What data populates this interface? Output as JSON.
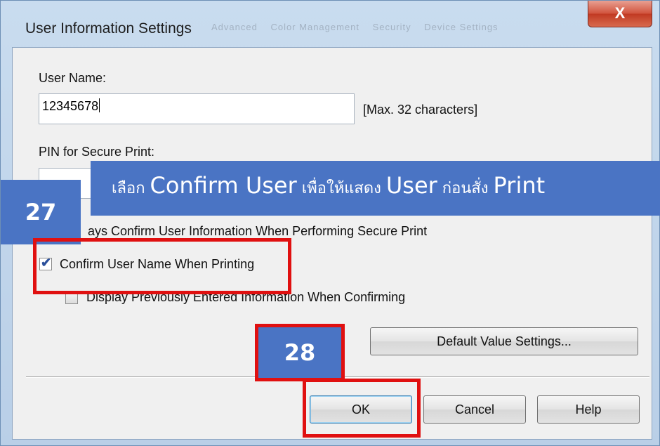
{
  "window": {
    "title": "User Information Settings",
    "background_tabs": [
      "Advanced",
      "Color Management",
      "Security",
      "Device Settings"
    ],
    "close_symbol": "X"
  },
  "form": {
    "user_name_label": "User Name:",
    "user_name_value": "12345678",
    "user_name_hint": "[Max. 32 characters]",
    "pin_label": "PIN for Secure Print:",
    "always_confirm_label": "ays Confirm User Information When Performing Secure Print",
    "confirm_user_name_label": "Confirm User Name When Printing",
    "confirm_user_name_checked": true,
    "display_previous_label": "Display Previously Entered Information When Confirming",
    "display_previous_checked": false
  },
  "buttons": {
    "default_value_settings": "Default Value Settings...",
    "ok": "OK",
    "cancel": "Cancel",
    "help": "Help"
  },
  "annotations": {
    "banner": {
      "part1": "เลือก ",
      "part2": "Confirm User",
      "part3": " เพื่อให้แสดง ",
      "part4": "User",
      "part5": " ก่อนสั่ง ",
      "part6": "Print"
    },
    "step_27": "27",
    "step_28": "28",
    "colors": {
      "banner": "#4a74c4",
      "highlight": "#e01010"
    }
  }
}
